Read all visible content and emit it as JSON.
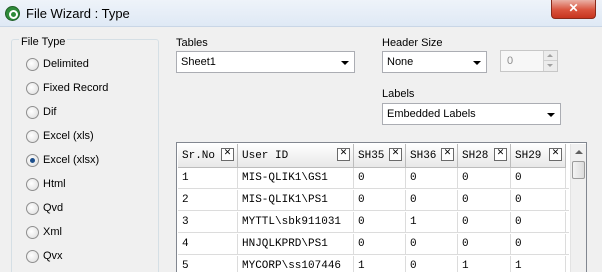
{
  "window": {
    "title": "File Wizard : Type"
  },
  "file_type": {
    "legend": "File Type",
    "options": [
      {
        "label": "Delimited",
        "checked": false
      },
      {
        "label": "Fixed Record",
        "checked": false
      },
      {
        "label": "Dif",
        "checked": false
      },
      {
        "label": "Excel (xls)",
        "checked": false
      },
      {
        "label": "Excel (xlsx)",
        "checked": true
      },
      {
        "label": "Html",
        "checked": false
      },
      {
        "label": "Qvd",
        "checked": false
      },
      {
        "label": "Xml",
        "checked": false
      },
      {
        "label": "Qvx",
        "checked": false
      }
    ]
  },
  "tables": {
    "label": "Tables",
    "value": "Sheet1"
  },
  "header_size": {
    "label": "Header Size",
    "value": "None",
    "spinner_value": "0"
  },
  "labels": {
    "label": "Labels",
    "value": "Embedded Labels"
  },
  "preview": {
    "columns": [
      "Sr.No",
      "User ID",
      "SH35",
      "SH36",
      "SH28",
      "SH29"
    ],
    "rows": [
      [
        "1",
        "MIS-QLIK1\\GS1",
        "0",
        "0",
        "0",
        "0"
      ],
      [
        "2",
        "MIS-QLIK1\\PS1",
        "0",
        "0",
        "0",
        "0"
      ],
      [
        "3",
        "MYTTL\\sbk911031",
        "0",
        "1",
        "0",
        "0"
      ],
      [
        "4",
        "HNJQLKPRD\\PS1",
        "0",
        "0",
        "0",
        "0"
      ],
      [
        "5",
        "MYCORP\\ss107446",
        "1",
        "0",
        "1",
        "1"
      ]
    ]
  }
}
